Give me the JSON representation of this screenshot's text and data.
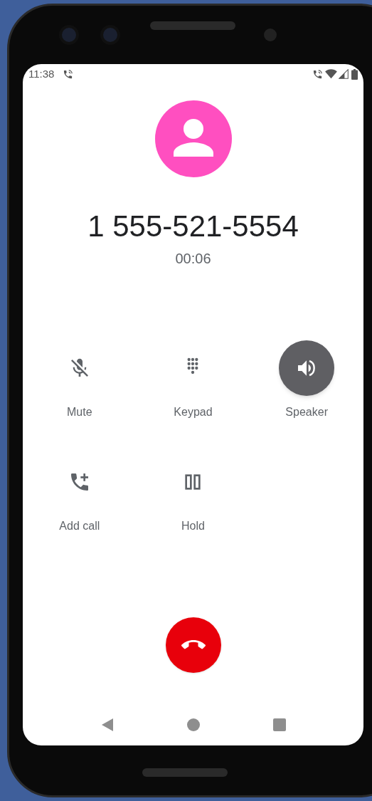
{
  "status_bar": {
    "time": "11:38"
  },
  "call": {
    "number": "1 555-521-5554",
    "duration": "00:06"
  },
  "controls": [
    {
      "label": "Mute",
      "selected": false
    },
    {
      "label": "Keypad",
      "selected": false
    },
    {
      "label": "Speaker",
      "selected": true
    },
    {
      "label": "Add call",
      "selected": false
    },
    {
      "label": "Hold",
      "selected": false
    }
  ]
}
